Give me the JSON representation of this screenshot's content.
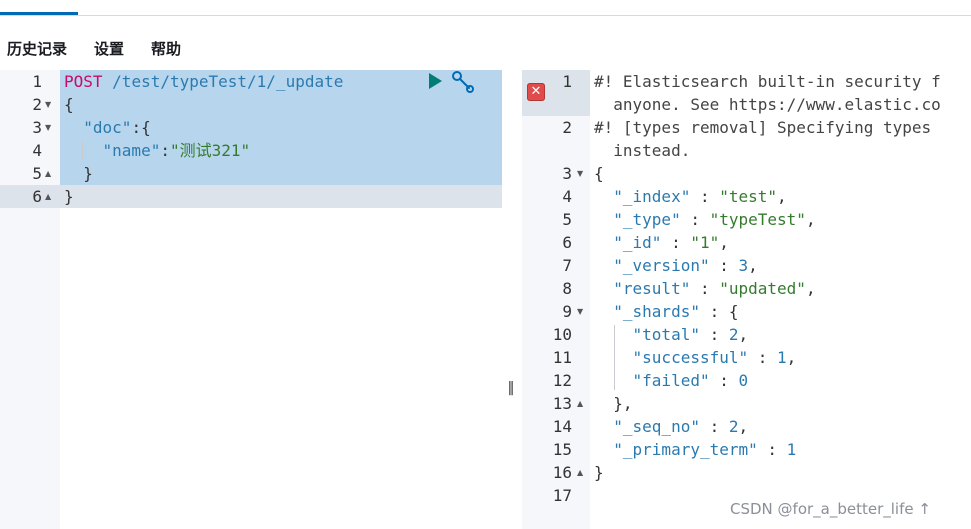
{
  "menu": {
    "items": [
      "历史记录",
      "设置",
      "帮助"
    ]
  },
  "request_editor": {
    "line_numbers": [
      "1",
      "2",
      "3",
      "4",
      "5",
      "6"
    ],
    "lines": [
      [
        {
          "t": "POST",
          "c": "k-method"
        },
        {
          "t": " ",
          "c": "k-punc"
        },
        {
          "t": "/test/typeTest/1/_update",
          "c": "k-url"
        }
      ],
      [
        {
          "t": "{",
          "c": "k-punc"
        }
      ],
      [
        {
          "t": "  ",
          "c": "k-punc"
        },
        {
          "t": "\"doc\"",
          "c": "k-key"
        },
        {
          "t": ":{",
          "c": "k-punc"
        }
      ],
      [
        {
          "t": "    ",
          "c": "k-punc"
        },
        {
          "t": "\"name\"",
          "c": "k-key"
        },
        {
          "t": ":",
          "c": "k-punc"
        },
        {
          "t": "\"测试321\"",
          "c": "k-str"
        }
      ],
      [
        {
          "t": "  }",
          "c": "k-punc"
        }
      ],
      [
        {
          "t": "}",
          "c": "k-punc"
        }
      ]
    ],
    "icons": {
      "run": "play-icon",
      "settings": "wrench-icon"
    }
  },
  "response_viewer": {
    "line_numbers": [
      "1",
      "",
      "2",
      "",
      "3",
      "4",
      "5",
      "6",
      "7",
      "8",
      "9",
      "10",
      "11",
      "12",
      "13",
      "14",
      "15",
      "16",
      "17"
    ],
    "lines": [
      [
        {
          "t": "#! Elasticsearch built-in security f",
          "c": "k-comment"
        }
      ],
      [
        {
          "t": "  anyone. See https://www.elastic.co",
          "c": "k-comment"
        }
      ],
      [
        {
          "t": "#! [types removal] Specifying types ",
          "c": "k-comment"
        }
      ],
      [
        {
          "t": "  instead.",
          "c": "k-comment"
        }
      ],
      [
        {
          "t": "{",
          "c": "k-punc"
        }
      ],
      [
        {
          "t": "  ",
          "c": "k-punc"
        },
        {
          "t": "\"_index\"",
          "c": "k-key"
        },
        {
          "t": " : ",
          "c": "k-punc"
        },
        {
          "t": "\"test\"",
          "c": "k-str"
        },
        {
          "t": ",",
          "c": "k-punc"
        }
      ],
      [
        {
          "t": "  ",
          "c": "k-punc"
        },
        {
          "t": "\"_type\"",
          "c": "k-key"
        },
        {
          "t": " : ",
          "c": "k-punc"
        },
        {
          "t": "\"typeTest\"",
          "c": "k-str"
        },
        {
          "t": ",",
          "c": "k-punc"
        }
      ],
      [
        {
          "t": "  ",
          "c": "k-punc"
        },
        {
          "t": "\"_id\"",
          "c": "k-key"
        },
        {
          "t": " : ",
          "c": "k-punc"
        },
        {
          "t": "\"1\"",
          "c": "k-str"
        },
        {
          "t": ",",
          "c": "k-punc"
        }
      ],
      [
        {
          "t": "  ",
          "c": "k-punc"
        },
        {
          "t": "\"_version\"",
          "c": "k-key"
        },
        {
          "t": " : ",
          "c": "k-punc"
        },
        {
          "t": "3",
          "c": "k-num"
        },
        {
          "t": ",",
          "c": "k-punc"
        }
      ],
      [
        {
          "t": "  ",
          "c": "k-punc"
        },
        {
          "t": "\"result\"",
          "c": "k-key"
        },
        {
          "t": " : ",
          "c": "k-punc"
        },
        {
          "t": "\"updated\"",
          "c": "k-str"
        },
        {
          "t": ",",
          "c": "k-punc"
        }
      ],
      [
        {
          "t": "  ",
          "c": "k-punc"
        },
        {
          "t": "\"_shards\"",
          "c": "k-key"
        },
        {
          "t": " : {",
          "c": "k-punc"
        }
      ],
      [
        {
          "t": "    ",
          "c": "k-punc"
        },
        {
          "t": "\"total\"",
          "c": "k-key"
        },
        {
          "t": " : ",
          "c": "k-punc"
        },
        {
          "t": "2",
          "c": "k-num"
        },
        {
          "t": ",",
          "c": "k-punc"
        }
      ],
      [
        {
          "t": "    ",
          "c": "k-punc"
        },
        {
          "t": "\"successful\"",
          "c": "k-key"
        },
        {
          "t": " : ",
          "c": "k-punc"
        },
        {
          "t": "1",
          "c": "k-num"
        },
        {
          "t": ",",
          "c": "k-punc"
        }
      ],
      [
        {
          "t": "    ",
          "c": "k-punc"
        },
        {
          "t": "\"failed\"",
          "c": "k-key"
        },
        {
          "t": " : ",
          "c": "k-punc"
        },
        {
          "t": "0",
          "c": "k-num"
        }
      ],
      [
        {
          "t": "  },",
          "c": "k-punc"
        }
      ],
      [
        {
          "t": "  ",
          "c": "k-punc"
        },
        {
          "t": "\"_seq_no\"",
          "c": "k-key"
        },
        {
          "t": " : ",
          "c": "k-punc"
        },
        {
          "t": "2",
          "c": "k-num"
        },
        {
          "t": ",",
          "c": "k-punc"
        }
      ],
      [
        {
          "t": "  ",
          "c": "k-punc"
        },
        {
          "t": "\"_primary_term\"",
          "c": "k-key"
        },
        {
          "t": " : ",
          "c": "k-punc"
        },
        {
          "t": "1",
          "c": "k-num"
        }
      ],
      [
        {
          "t": "}",
          "c": "k-punc"
        }
      ],
      [
        {
          "t": "",
          "c": "k-punc"
        }
      ]
    ],
    "icons": {
      "warning": "error-icon"
    }
  },
  "divider": {
    "glyph": "‖"
  },
  "watermark": {
    "text": "CSDN @for_a_better_life ↑"
  },
  "colors": {
    "accent": "#006bb4",
    "selection": "#b7d6ee",
    "method": "#c80a68",
    "key": "#2a7ab0",
    "string": "#357b2e"
  }
}
